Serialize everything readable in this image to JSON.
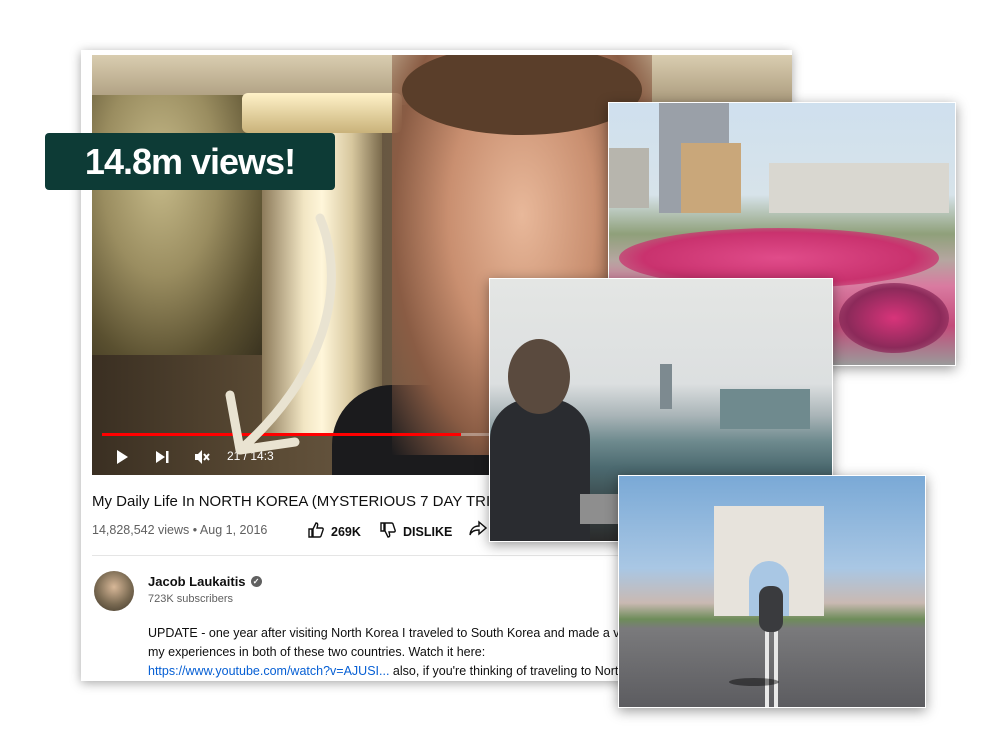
{
  "badge": {
    "text": "14.8m views!"
  },
  "video": {
    "progress_fraction": 0.52,
    "time_display": "21 / 14:3"
  },
  "title": "My Daily Life In NORTH KOREA (MYSTERIOUS 7 DAY TRIP",
  "meta": {
    "views_date": "14,828,542 views • Aug 1, 2016",
    "likes": "269K",
    "dislike_label": "DISLIKE"
  },
  "channel": {
    "name": "Jacob Laukaitis",
    "subscribers": "723K subscribers"
  },
  "description": {
    "line1": "UPDATE - one year after visiting North Korea I traveled to South Korea and made a video",
    "line2": "my experiences in both of these two countries. Watch it here:",
    "link": "https://www.youtube.com/watch?v=AJUSI...",
    "line3_rest": " also, if you're thinking of traveling to North K"
  },
  "colors": {
    "badge_bg": "#0d3b36",
    "progress": "#ff0000",
    "link": "#065fd4"
  },
  "icons": {
    "play": "play-icon",
    "next": "next-icon",
    "mute": "mute-icon",
    "like": "thumbs-up-icon",
    "dislike": "thumbs-down-icon",
    "share": "share-icon",
    "verified": "verified-icon"
  }
}
